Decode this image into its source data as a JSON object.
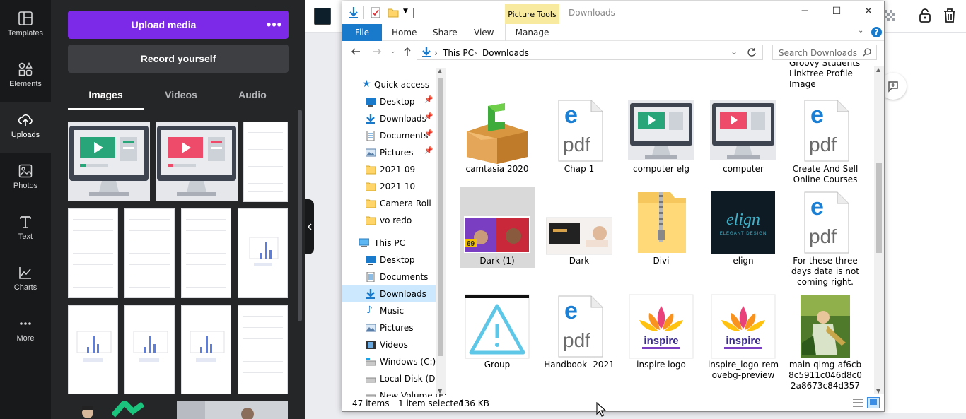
{
  "canva": {
    "rail": [
      {
        "label": "Templates",
        "icon": "templates-icon"
      },
      {
        "label": "Elements",
        "icon": "elements-icon"
      },
      {
        "label": "Uploads",
        "icon": "uploads-icon"
      },
      {
        "label": "Photos",
        "icon": "photos-icon"
      },
      {
        "label": "Text",
        "icon": "text-icon"
      },
      {
        "label": "Charts",
        "icon": "charts-icon"
      },
      {
        "label": "More",
        "icon": "more-icon"
      }
    ],
    "panel": {
      "upload_label": "Upload media",
      "more_label": "•••",
      "record_label": "Record yourself",
      "tabs": [
        "Images",
        "Videos",
        "Audio"
      ]
    }
  },
  "explorer": {
    "context_tab": "Picture Tools",
    "window_title": "Downloads",
    "ribbon_tabs": [
      "File",
      "Home",
      "Share",
      "View",
      "Manage"
    ],
    "breadcrumb": [
      "This PC",
      "Downloads"
    ],
    "search_placeholder": "Search Downloads",
    "nav": [
      {
        "label": "Quick access",
        "indent": 0,
        "pinned": false
      },
      {
        "label": "Desktop",
        "indent": 1,
        "pinned": true
      },
      {
        "label": "Downloads",
        "indent": 1,
        "pinned": true
      },
      {
        "label": "Documents",
        "indent": 1,
        "pinned": true
      },
      {
        "label": "Pictures",
        "indent": 1,
        "pinned": true
      },
      {
        "label": "2021-09",
        "indent": 1,
        "pinned": false
      },
      {
        "label": "2021-10",
        "indent": 1,
        "pinned": false
      },
      {
        "label": "Camera Roll",
        "indent": 1,
        "pinned": false
      },
      {
        "label": "vo redo",
        "indent": 1,
        "pinned": false
      },
      {
        "label": "This PC",
        "indent": 0,
        "pinned": false
      },
      {
        "label": "Desktop",
        "indent": 1,
        "pinned": false
      },
      {
        "label": "Documents",
        "indent": 1,
        "pinned": false
      },
      {
        "label": "Downloads",
        "indent": 1,
        "pinned": false
      },
      {
        "label": "Music",
        "indent": 1,
        "pinned": false
      },
      {
        "label": "Pictures",
        "indent": 1,
        "pinned": false
      },
      {
        "label": "Videos",
        "indent": 1,
        "pinned": false
      },
      {
        "label": "Windows (C:)",
        "indent": 1,
        "pinned": false
      },
      {
        "label": "Local Disk (D:)",
        "indent": 1,
        "pinned": false
      },
      {
        "label": "New Volume (E:)",
        "indent": 1,
        "pinned": false
      }
    ],
    "top_partial_label": "Groovy Students Linktree Profile Image",
    "files": [
      {
        "name": "camtasia 2020",
        "kind": "box"
      },
      {
        "name": "Chap 1",
        "kind": "pdf"
      },
      {
        "name": "computer elg",
        "kind": "monitor-green"
      },
      {
        "name": "computer",
        "kind": "monitor-pink"
      },
      {
        "name": "Create And Sell Online Courses",
        "kind": "pdf"
      },
      {
        "name": "Dark (1)",
        "kind": "dark1"
      },
      {
        "name": "Dark",
        "kind": "dark"
      },
      {
        "name": "Divi",
        "kind": "zip"
      },
      {
        "name": "elign",
        "kind": "elign"
      },
      {
        "name": "For these three days data is not coming right.",
        "kind": "pdf"
      },
      {
        "name": "Group",
        "kind": "group"
      },
      {
        "name": "Handbook -2021",
        "kind": "pdf"
      },
      {
        "name": "inspire logo",
        "kind": "inspire"
      },
      {
        "name": "inspire_logo-removebg-preview",
        "kind": "inspire"
      },
      {
        "name": "main-qimg-af6cb8c5911c046d8c02a8673c84d357",
        "kind": "painting"
      }
    ],
    "elign_text": "elign",
    "elign_sub": "ELEGANT DESIGN",
    "inspire_text": "inspire",
    "pdf_text": "pdf",
    "status": {
      "count": "47 items",
      "selected": "1 item selected",
      "size": "136 KB"
    }
  }
}
